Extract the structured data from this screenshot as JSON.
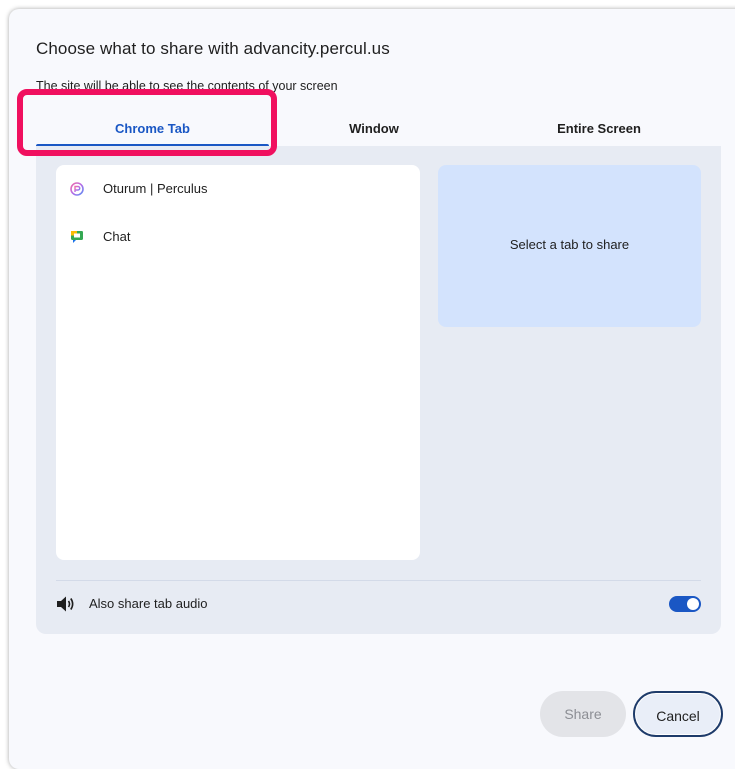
{
  "dialog": {
    "title": "Choose what to share with advancity.percul.us",
    "subtitle": "The site will be able to see the contents of your screen"
  },
  "tabs": [
    {
      "label": "Chrome Tab",
      "active": true
    },
    {
      "label": "Window",
      "active": false
    },
    {
      "label": "Entire Screen",
      "active": false
    }
  ],
  "tab_list": {
    "items": [
      {
        "label": "Oturum | Perculus",
        "icon": "perculus-icon"
      },
      {
        "label": "Chat",
        "icon": "google-chat-icon"
      }
    ]
  },
  "preview": {
    "text": "Select a tab to share"
  },
  "audio": {
    "label": "Also share tab audio",
    "enabled": true
  },
  "buttons": {
    "share": "Share",
    "cancel": "Cancel"
  },
  "colors": {
    "accent": "#1a57c4",
    "highlight": "#f0105f",
    "preview_bg": "#d3e3fd",
    "panel_bg": "#e7ebf3"
  }
}
